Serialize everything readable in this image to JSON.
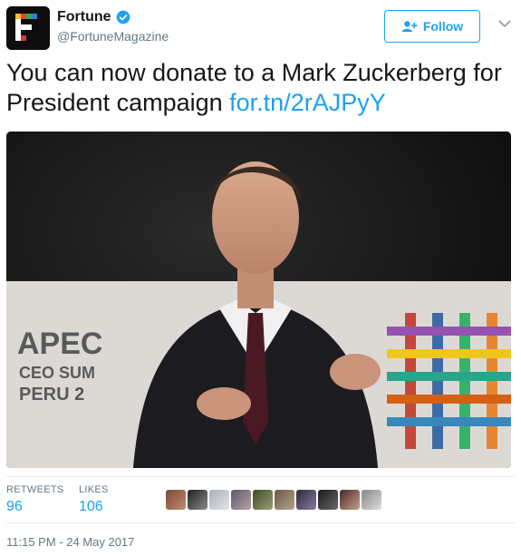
{
  "account": {
    "display_name": "Fortune",
    "handle": "@FortuneMagazine",
    "verified": true,
    "avatar_icon": "fortune-logo-icon"
  },
  "follow_button": {
    "label": "Follow",
    "icon": "add-user-icon"
  },
  "more_menu": {
    "icon": "chevron-down-icon"
  },
  "tweet": {
    "text": "You can now donate to a Mark Zuckerberg for President campaign",
    "link": "for.tn/2rAJPyY"
  },
  "media": {
    "type": "photo",
    "banner_text_lines": [
      "APEC",
      "CEO SUM",
      "PERU 2"
    ]
  },
  "stats": {
    "retweets_label": "RETWEETS",
    "retweets_value": "96",
    "likes_label": "LIKES",
    "likes_value": "106"
  },
  "liker_avatars": [
    "avatar-1",
    "avatar-2",
    "avatar-3",
    "avatar-4",
    "avatar-5",
    "avatar-6",
    "avatar-7",
    "avatar-8",
    "avatar-9",
    "avatar-10"
  ],
  "timestamp": "11:15 PM - 24 May 2017",
  "colors": {
    "link_blue": "#1da1f2",
    "text": "#14171a",
    "muted": "#657786",
    "border": "#e6ecf0"
  }
}
